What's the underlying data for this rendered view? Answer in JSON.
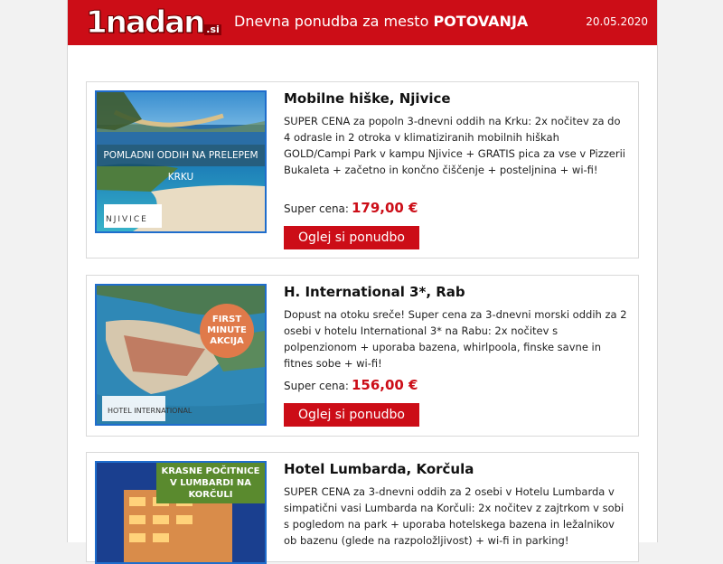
{
  "header": {
    "logo_main": "1nadan",
    "logo_tld": ".si",
    "title_prefix": "Dnevna ponudba za mesto",
    "title_city": "POTOVANJA",
    "date": "20.05.2020"
  },
  "colors": {
    "brand_red": "#cc0d17",
    "border_blue": "#1f6dcc"
  },
  "offers": [
    {
      "title": "Mobilne hiške, Njivice",
      "description": "SUPER CENA za popoln 3-dnevni oddih na Krku: 2x nočitev za do 4 odrasle in 2 otroka v klimatiziranih mobilnih hiškah GOLD/Campi Park v kampu Njivice + GRATIS pica za vse v Pizzerii Bukaleta + začetno in končno čiščenje + posteljnina + wi-fi!",
      "price_label": "Super cena:",
      "price_value": "179,00 €",
      "button_label": "Oglej si ponudbo",
      "image_banner": "POMLADNI ODDIH NA PRELEPEM KRKU",
      "image_logo": "NJIVICE"
    },
    {
      "title": "H. International 3*, Rab",
      "description": "Dopust na otoku sreče! Super cena za 3-dnevni morski oddih za 2 osebi v hotelu International 3* na Rabu: 2x nočitev s polpenzionom + uporaba bazena, whirlpoola, finske savne in fitnes sobe + wi-fi!",
      "price_label": "Super cena:",
      "price_value": "156,00 €",
      "button_label": "Oglej si ponudbo",
      "image_badge": "FIRST MINUTE AKCIJA",
      "image_logo": "HOTEL INTERNATIONAL"
    },
    {
      "title": "Hotel Lumbarda, Korčula",
      "description": "SUPER CENA za 3-dnevni oddih za 2 osebi v Hotelu Lumbarda v simpatični vasi Lumbarda na Korčuli: 2x nočitev z zajtrkom v sobi s pogledom na park + uporaba hotelskega bazena in ležalnikov ob bazenu (glede na razpoložljivost) + wi-fi in parking!",
      "image_banner": "KRASNE POČITNICE V LUMBARDI NA KORČULI"
    }
  ]
}
